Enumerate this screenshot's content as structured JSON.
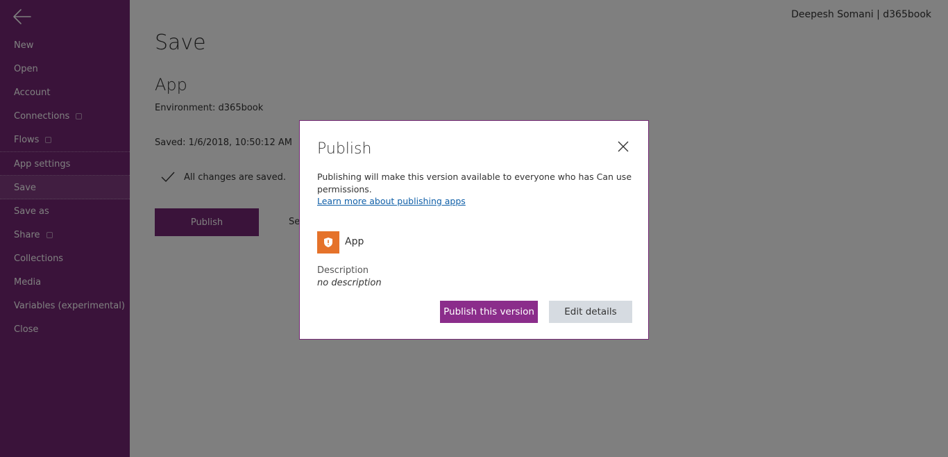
{
  "sidebar": {
    "items": [
      {
        "label": "New",
        "external": false
      },
      {
        "label": "Open",
        "external": false
      },
      {
        "label": "Account",
        "external": false
      },
      {
        "label": "Connections",
        "external": true
      },
      {
        "label": "Flows",
        "external": true
      },
      {
        "label": "App settings",
        "external": false
      },
      {
        "label": "Save",
        "external": false,
        "selected": true
      },
      {
        "label": "Save as",
        "external": false
      },
      {
        "label": "Share",
        "external": true
      },
      {
        "label": "Collections",
        "external": false
      },
      {
        "label": "Media",
        "external": false
      },
      {
        "label": "Variables (experimental)",
        "external": false
      },
      {
        "label": "Close",
        "external": false
      }
    ]
  },
  "header": {
    "user": "Deepesh Somani | d365book"
  },
  "main": {
    "title": "Save",
    "app_name": "App",
    "environment": "Environment: d365book",
    "saved": "Saved: 1/6/2018, 10:50:12 AM",
    "changes_status": "All changes are saved.",
    "publish_label": "Publish",
    "see_all_partial": "Se"
  },
  "dialog": {
    "title": "Publish",
    "message": "Publishing will make this version available to everyone who has Can use permissions.",
    "link": "Learn more about publishing apps",
    "app_name": "App",
    "description_label": "Description",
    "description_value": "no description",
    "publish_version_label": "Publish this version",
    "edit_details_label": "Edit details"
  },
  "colors": {
    "brand": "#742774",
    "app_icon": "#e5722a",
    "link": "#0f5fa8"
  }
}
